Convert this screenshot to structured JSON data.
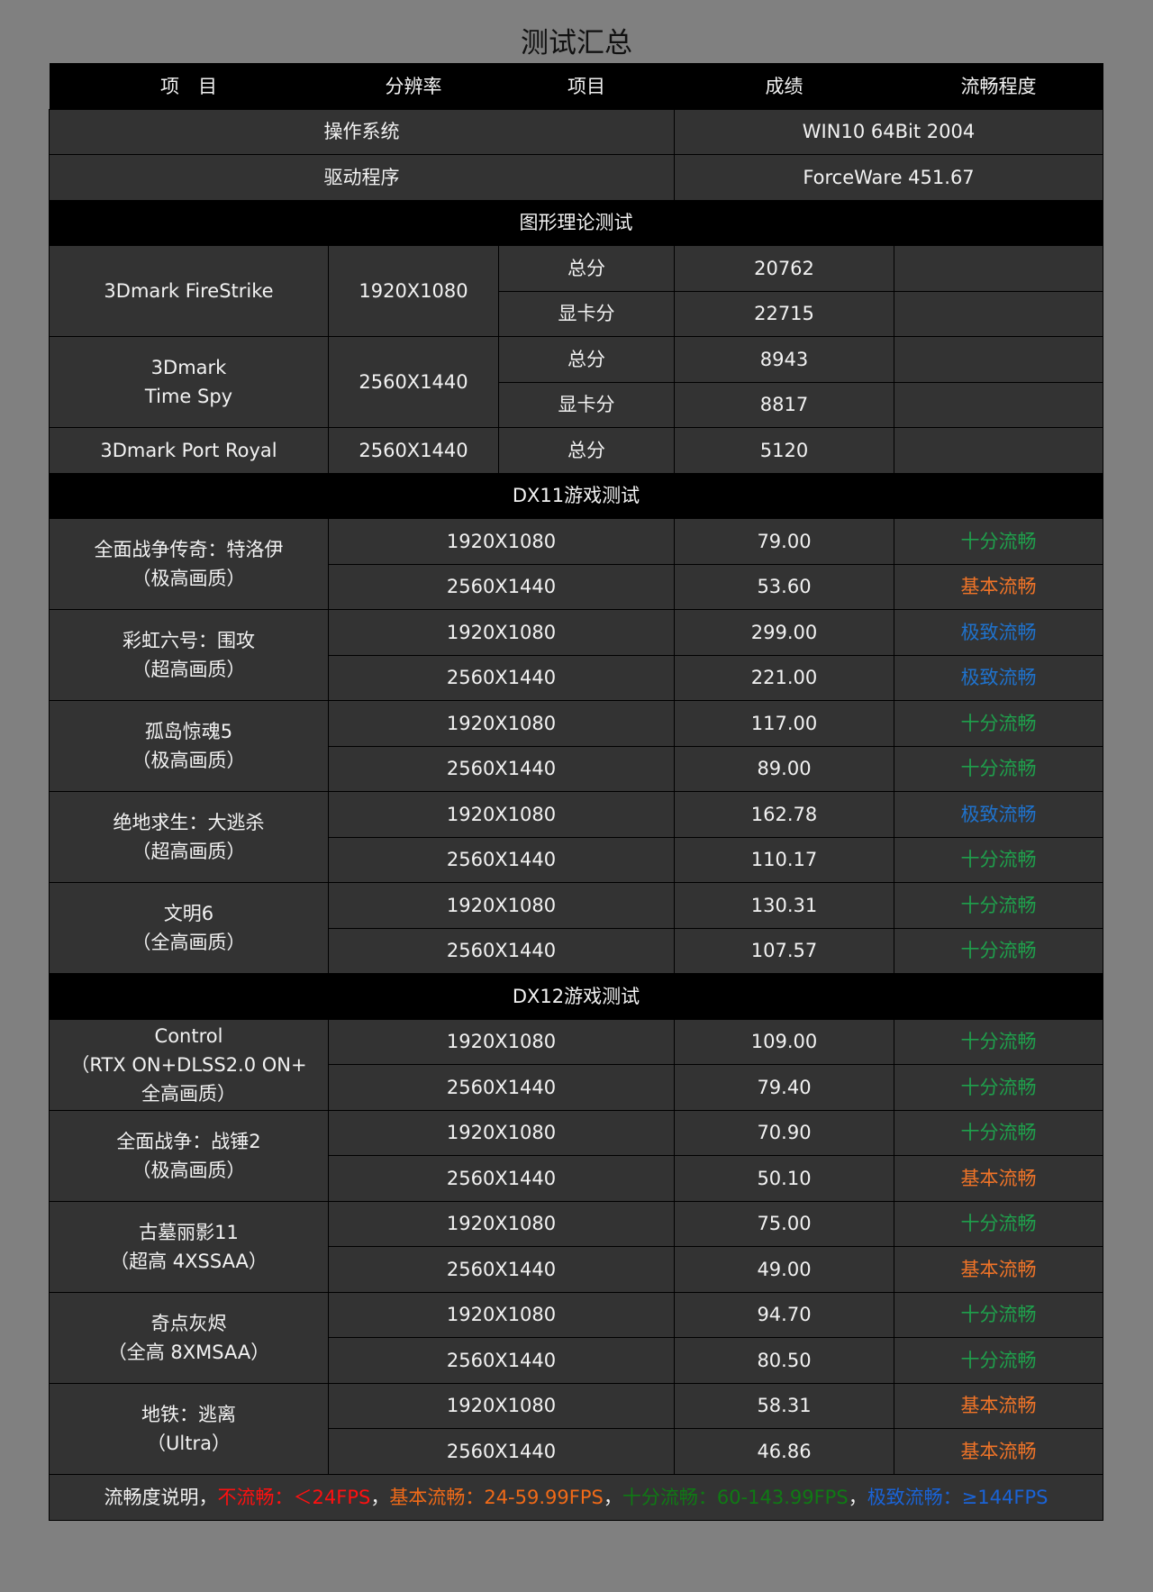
{
  "title": "测试汇总",
  "header": {
    "item": "项　目",
    "resolution": "分辨率",
    "sub_item": "项目",
    "score": "成绩",
    "smoothness": "流畅程度"
  },
  "system": {
    "os_label": "操作系统",
    "os_value": "WIN10 64Bit 2004",
    "driver_label": "驱动程序",
    "driver_value": "ForceWare 451.67"
  },
  "theory": {
    "section": "图形理论测试",
    "firestrike": {
      "name": "3Dmark FireStrike",
      "res": "1920X1080",
      "total_label": "总分",
      "total": "20762",
      "gpu_label": "显卡分",
      "gpu": "22715"
    },
    "timespy": {
      "name1": "3Dmark",
      "name2": "Time Spy",
      "res": "2560X1440",
      "total_label": "总分",
      "total": "8943",
      "gpu_label": "显卡分",
      "gpu": "8817"
    },
    "portroyal": {
      "name": "3Dmark Port Royal",
      "res": "2560X1440",
      "total_label": "总分",
      "total": "5120"
    }
  },
  "status_colors": {
    "十分流畅": "#1fa04c",
    "基本流畅": "#f07428",
    "极致流畅": "#1f72cc"
  },
  "dx11": {
    "section": "DX11游戏测试",
    "games": [
      {
        "name": [
          "全面战争传奇：特洛伊",
          "（极高画质）"
        ],
        "rows": [
          {
            "res": "1920X1080",
            "fps": "79.00",
            "status": "十分流畅"
          },
          {
            "res": "2560X1440",
            "fps": "53.60",
            "status": "基本流畅"
          }
        ]
      },
      {
        "name": [
          "彩虹六号：围攻",
          "（超高画质）"
        ],
        "rows": [
          {
            "res": "1920X1080",
            "fps": "299.00",
            "status": "极致流畅"
          },
          {
            "res": "2560X1440",
            "fps": "221.00",
            "status": "极致流畅"
          }
        ]
      },
      {
        "name": [
          "孤岛惊魂5",
          "（极高画质）"
        ],
        "rows": [
          {
            "res": "1920X1080",
            "fps": "117.00",
            "status": "十分流畅"
          },
          {
            "res": "2560X1440",
            "fps": "89.00",
            "status": "十分流畅"
          }
        ]
      },
      {
        "name": [
          "绝地求生：大逃杀",
          "（超高画质）"
        ],
        "rows": [
          {
            "res": "1920X1080",
            "fps": "162.78",
            "status": "极致流畅"
          },
          {
            "res": "2560X1440",
            "fps": "110.17",
            "status": "十分流畅"
          }
        ]
      },
      {
        "name": [
          "文明6",
          "（全高画质）"
        ],
        "rows": [
          {
            "res": "1920X1080",
            "fps": "130.31",
            "status": "十分流畅"
          },
          {
            "res": "2560X1440",
            "fps": "107.57",
            "status": "十分流畅"
          }
        ]
      }
    ]
  },
  "dx12": {
    "section": "DX12游戏测试",
    "games": [
      {
        "name": [
          "Control",
          "（RTX ON+DLSS2.0 ON+",
          "全高画质）"
        ],
        "rows": [
          {
            "res": "1920X1080",
            "fps": "109.00",
            "status": "十分流畅"
          },
          {
            "res": "2560X1440",
            "fps": "79.40",
            "status": "十分流畅"
          }
        ]
      },
      {
        "name": [
          "全面战争：战锤2",
          "（极高画质）"
        ],
        "rows": [
          {
            "res": "1920X1080",
            "fps": "70.90",
            "status": "十分流畅"
          },
          {
            "res": "2560X1440",
            "fps": "50.10",
            "status": "基本流畅"
          }
        ]
      },
      {
        "name": [
          "古墓丽影11",
          "（超高 4XSSAA）"
        ],
        "rows": [
          {
            "res": "1920X1080",
            "fps": "75.00",
            "status": "十分流畅"
          },
          {
            "res": "2560X1440",
            "fps": "49.00",
            "status": "基本流畅"
          }
        ]
      },
      {
        "name": [
          "奇点灰烬",
          "（全高 8XMSAA）"
        ],
        "rows": [
          {
            "res": "1920X1080",
            "fps": "94.70",
            "status": "十分流畅"
          },
          {
            "res": "2560X1440",
            "fps": "80.50",
            "status": "十分流畅"
          }
        ]
      },
      {
        "name": [
          "地铁：逃离",
          "（Ultra）"
        ],
        "rows": [
          {
            "res": "1920X1080",
            "fps": "58.31",
            "status": "基本流畅"
          },
          {
            "res": "2560X1440",
            "fps": "46.86",
            "status": "基本流畅"
          }
        ]
      }
    ]
  },
  "legend": {
    "prefix": "流畅度说明，",
    "items": [
      {
        "text": "不流畅：＜24FPS",
        "color": "#ff1010"
      },
      {
        "text": "基本流畅：24-59.99FPS",
        "color": "#f06a18"
      },
      {
        "text": "十分流畅：60-143.99FPS",
        "color": "#0f7a14"
      },
      {
        "text": "极致流畅：≥144FPS",
        "color": "#1a63d6"
      }
    ],
    "separator": "，"
  }
}
